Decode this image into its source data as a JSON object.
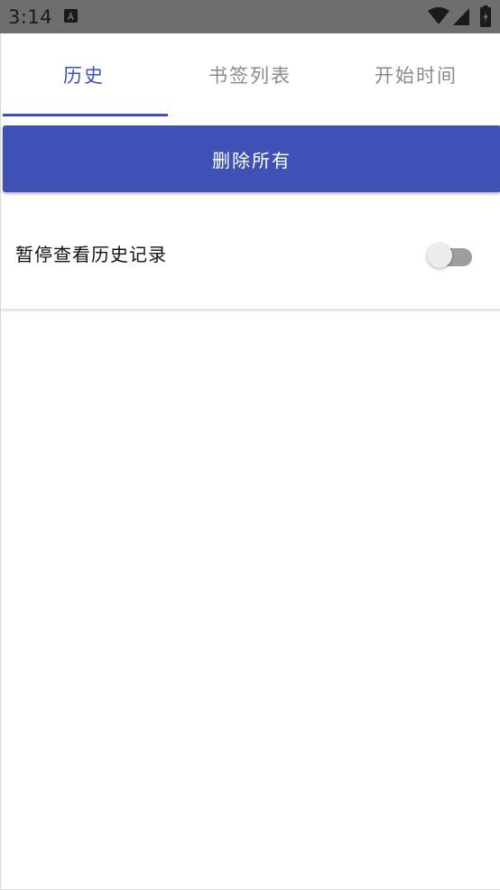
{
  "status_bar": {
    "time": "3:14",
    "icons": [
      "a-notification-icon",
      "wifi-icon",
      "cellular-signal-icon",
      "battery-icon"
    ]
  },
  "tabs": [
    {
      "label": "历史",
      "active": true
    },
    {
      "label": "书签列表",
      "active": false
    },
    {
      "label": "开始时间",
      "active": false
    }
  ],
  "actions": {
    "delete_all_label": "删除所有"
  },
  "settings": {
    "pause_history_label": "暂停查看历史记录",
    "pause_history_enabled": false
  },
  "colors": {
    "accent": "#3f51b5",
    "status_bar": "#6e6e6e",
    "inactive_tab_text": "#8a8a8a",
    "toggle_track_off": "#9e9e9e",
    "toggle_thumb_off": "#ececec"
  }
}
